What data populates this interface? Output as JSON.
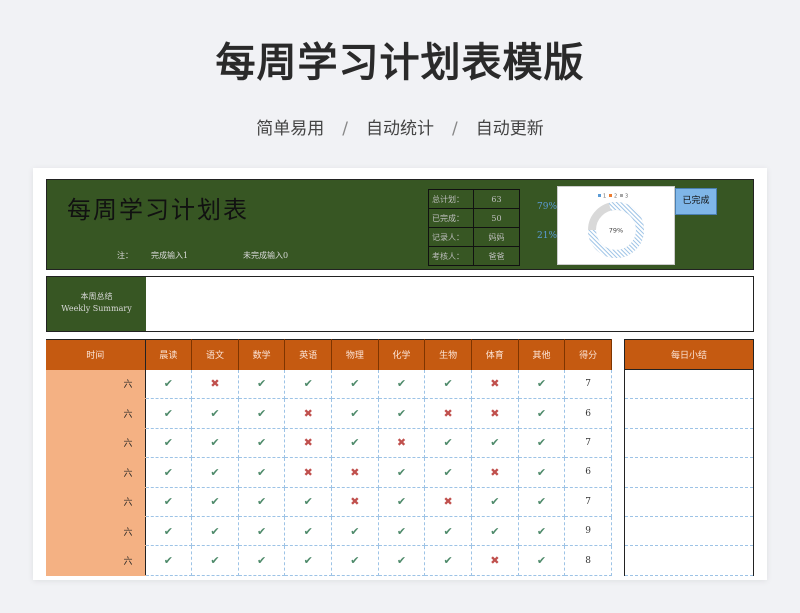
{
  "page": {
    "title": "每周学习计划表模版",
    "features": [
      "简单易用",
      "自动统计",
      "自动更新"
    ],
    "separator": "/"
  },
  "sheet": {
    "title": "每周学习计划表",
    "note_prefix": "注：",
    "note_done": "完成输入1",
    "note_undone": "未完成输入0",
    "stats": [
      {
        "label": "总计划：",
        "value": "63"
      },
      {
        "label": "已完成：",
        "value": "50"
      },
      {
        "label": "记录人：",
        "value": "妈妈"
      },
      {
        "label": "考核人：",
        "value": "爸爸"
      }
    ],
    "pct_done": "79%",
    "pct_undone": "21%",
    "chart": {
      "center_label": "79%",
      "legend": [
        "1",
        "2",
        "3"
      ],
      "done_fraction": 0.79,
      "colors": {
        "done": "#9dc3e6",
        "undone": "#d9d9d9"
      }
    },
    "done_badge": "已完成",
    "summary_label_cn": "本周总结",
    "summary_label_en": "Weekly Summary",
    "columns": [
      "时间",
      "晨读",
      "语文",
      "数学",
      "英语",
      "物理",
      "化学",
      "生物",
      "体育",
      "其他",
      "得分"
    ],
    "daily_header": "每日小结",
    "rows": [
      {
        "day": "六",
        "marks": [
          "✔",
          "✖",
          "✔",
          "✔",
          "✔",
          "✔",
          "✔",
          "✖",
          "✔"
        ],
        "score": "7"
      },
      {
        "day": "六",
        "marks": [
          "✔",
          "✔",
          "✔",
          "✖",
          "✔",
          "✔",
          "✖",
          "✖",
          "✔"
        ],
        "score": "6"
      },
      {
        "day": "六",
        "marks": [
          "✔",
          "✔",
          "✔",
          "✖",
          "✔",
          "✖",
          "✔",
          "✔",
          "✔"
        ],
        "score": "7"
      },
      {
        "day": "六",
        "marks": [
          "✔",
          "✔",
          "✔",
          "✖",
          "✖",
          "✔",
          "✔",
          "✖",
          "✔"
        ],
        "score": "6"
      },
      {
        "day": "六",
        "marks": [
          "✔",
          "✔",
          "✔",
          "✔",
          "✖",
          "✔",
          "✖",
          "✔",
          "✔"
        ],
        "score": "7"
      },
      {
        "day": "六",
        "marks": [
          "✔",
          "✔",
          "✔",
          "✔",
          "✔",
          "✔",
          "✔",
          "✔",
          "✔"
        ],
        "score": "9"
      },
      {
        "day": "六",
        "marks": [
          "✔",
          "✔",
          "✔",
          "✔",
          "✔",
          "✔",
          "✔",
          "✖",
          "✔"
        ],
        "score": "8"
      }
    ]
  }
}
